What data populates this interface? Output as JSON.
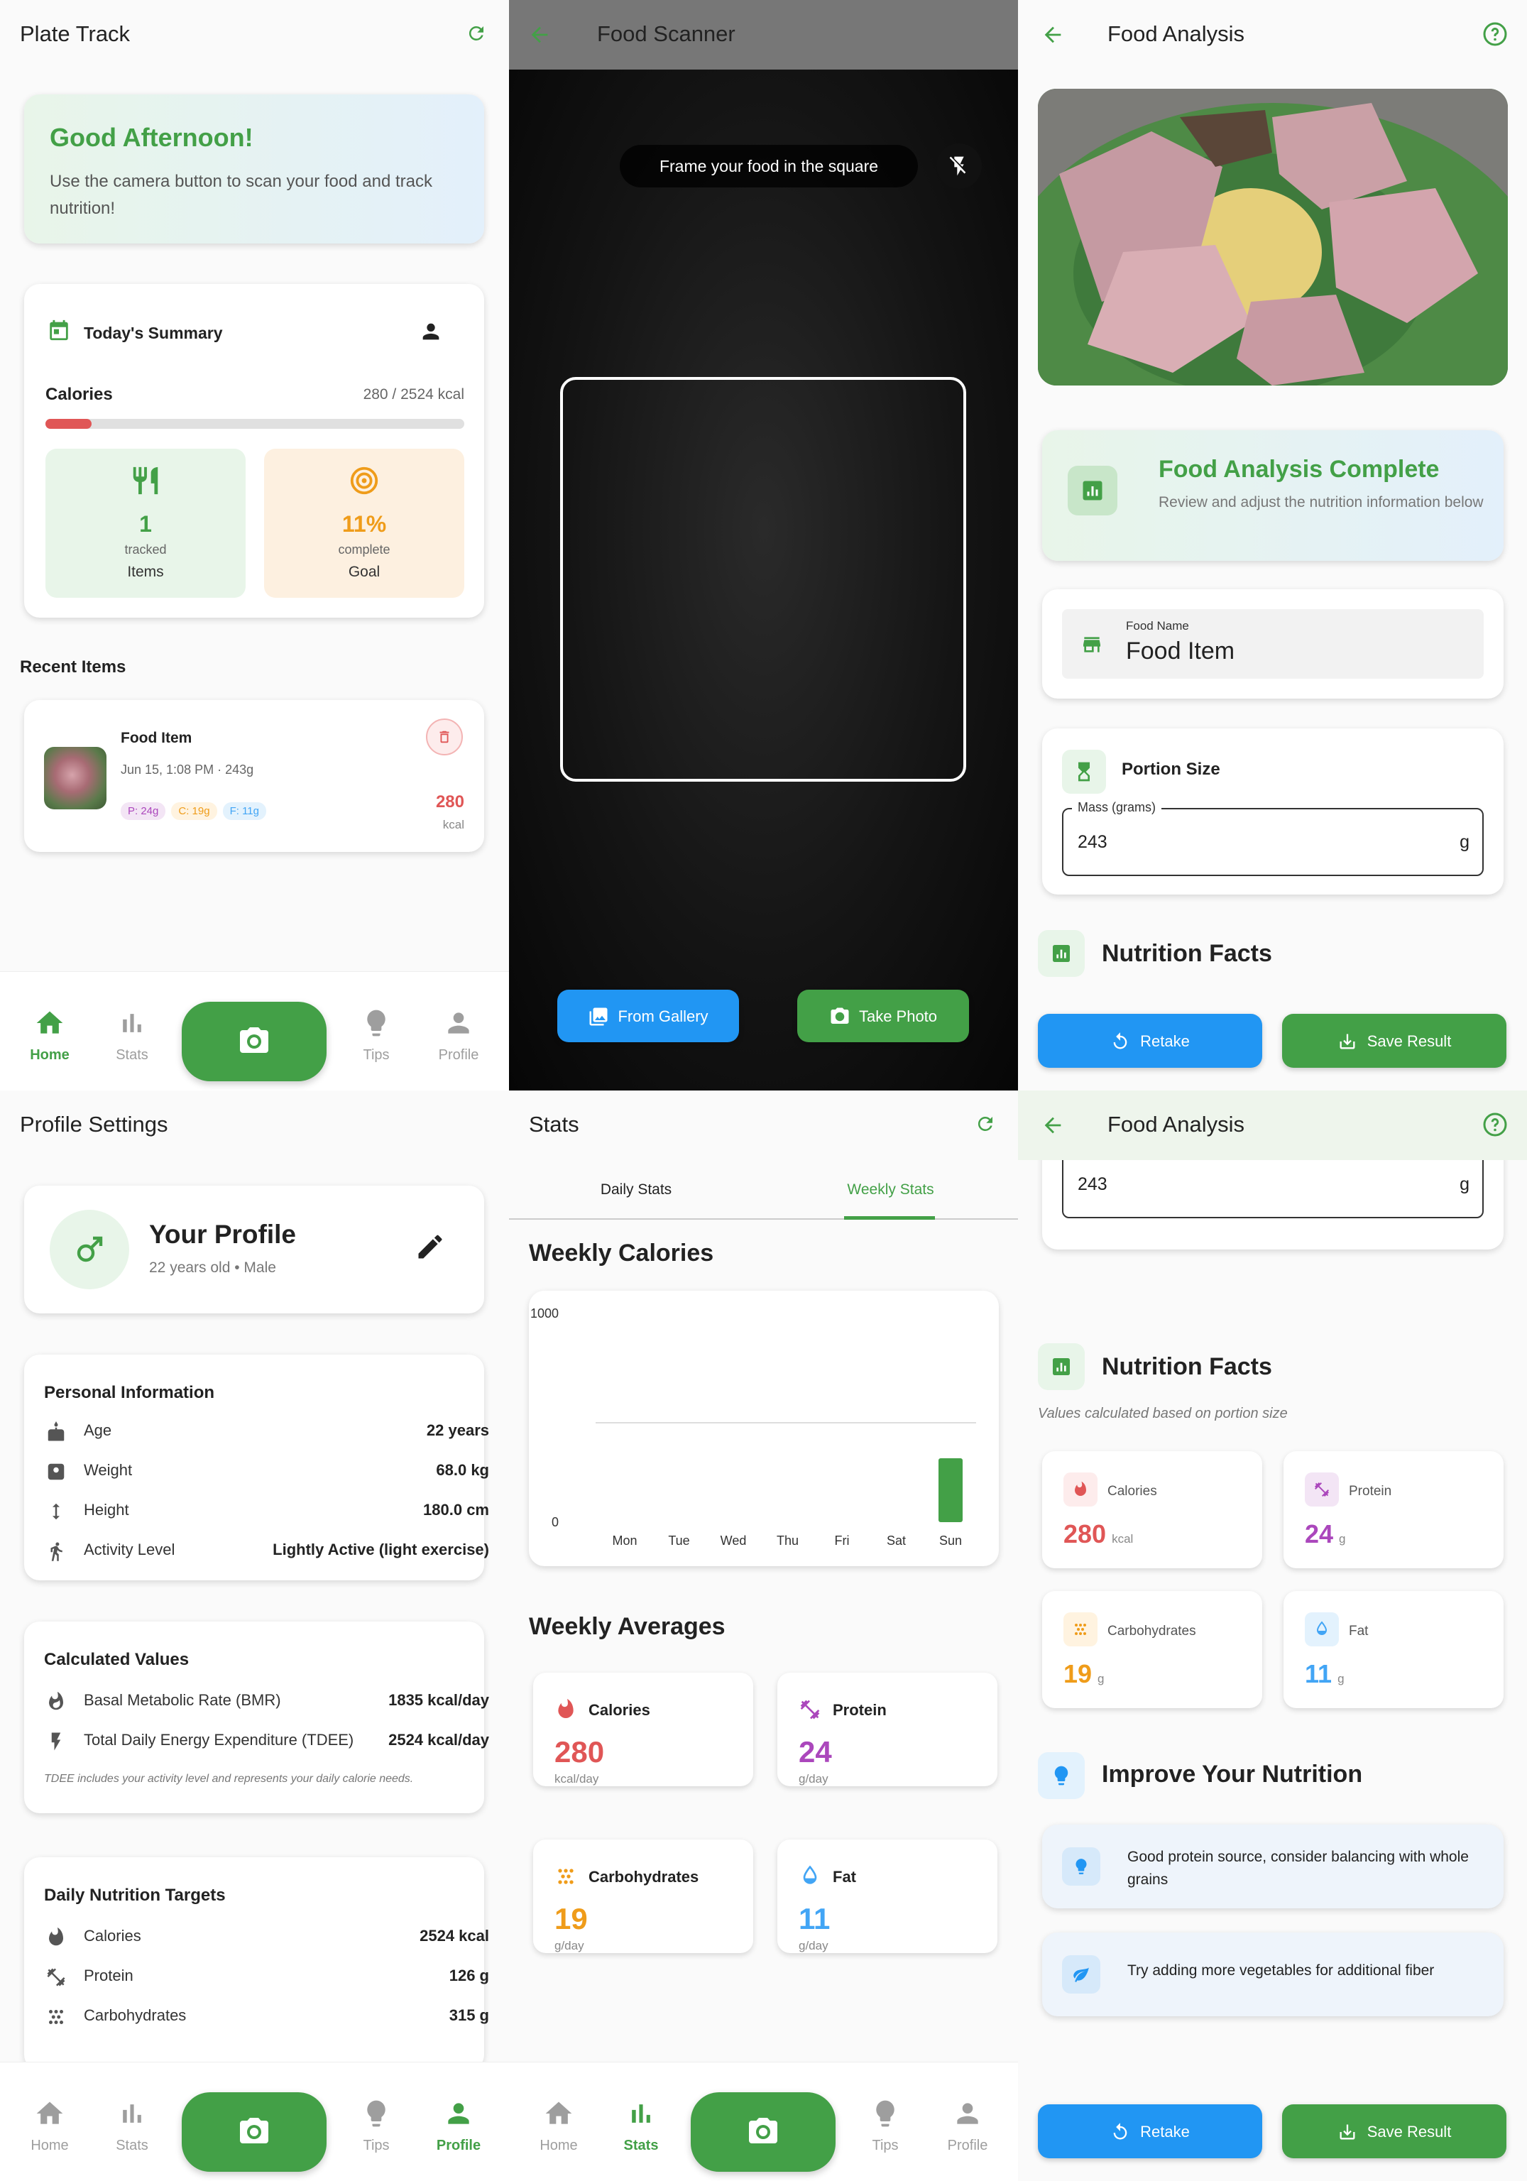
{
  "home": {
    "app_title": "Plate Track",
    "greeting_title": "Good Afternoon!",
    "greeting_text": "Use the camera button to scan your food and track nutrition!",
    "summary_title": "Today's Summary",
    "calories_label": "Calories",
    "calories_value": "280 / 2524 kcal",
    "calories_progress": 0.11,
    "items_count": "1",
    "items_sub": "tracked",
    "items_label": "Items",
    "goal_value": "11%",
    "goal_sub": "complete",
    "goal_label": "Goal",
    "recent_title": "Recent Items",
    "recent_item": {
      "name": "Food Item",
      "meta": "Jun 15, 1:08 PM · 243g",
      "protein_chip": "P: 24g",
      "carb_chip": "C: 19g",
      "fat_chip": "F: 11g",
      "kcal": "280",
      "kcal_unit": "kcal"
    }
  },
  "nav": {
    "home": "Home",
    "stats": "Stats",
    "tips": "Tips",
    "profile": "Profile"
  },
  "scanner": {
    "title": "Food Scanner",
    "hint": "Frame your food in the square",
    "gallery_button": "From Gallery",
    "photo_button": "Take Photo"
  },
  "analysis": {
    "title": "Food Analysis",
    "complete_title": "Food Analysis Complete",
    "complete_text": "Review and adjust the nutrition information below",
    "food_name_label": "Food Name",
    "food_name_value": "Food Item",
    "portion_title": "Portion Size",
    "mass_label": "Mass (grams)",
    "mass_value": "243",
    "mass_unit": "g",
    "nutrition_title": "Nutrition Facts",
    "nutrition_note": "Values calculated based on portion size",
    "calories_label": "Calories",
    "calories_value": "280",
    "calories_unit": "kcal",
    "protein_label": "Protein",
    "protein_value": "24",
    "protein_unit": "g",
    "carbs_label": "Carbohydrates",
    "carbs_value": "19",
    "carbs_unit": "g",
    "fat_label": "Fat",
    "fat_value": "11",
    "fat_unit": "g",
    "improve_title": "Improve Your Nutrition",
    "tip1": "Good protein source, consider balancing with whole grains",
    "tip2": "Try adding more vegetables for additional fiber",
    "retake_button": "Retake",
    "save_button": "Save Result"
  },
  "profile": {
    "title": "Profile Settings",
    "your_profile": "Your Profile",
    "profile_sub": "22 years old • Male",
    "personal_title": "Personal Information",
    "age_label": "Age",
    "age_value": "22 years",
    "weight_label": "Weight",
    "weight_value": "68.0 kg",
    "height_label": "Height",
    "height_value": "180.0 cm",
    "activity_label": "Activity Level",
    "activity_value": "Lightly Active (light exercise)",
    "calc_title": "Calculated Values",
    "bmr_label": "Basal Metabolic Rate (BMR)",
    "bmr_value": "1835 kcal/day",
    "tdee_label": "Total Daily Energy Expenditure (TDEE)",
    "tdee_value": "2524 kcal/day",
    "tdee_note": "TDEE includes your activity level and represents your daily calorie needs.",
    "targets_title": "Daily Nutrition Targets",
    "t_cal_label": "Calories",
    "t_cal_value": "2524 kcal",
    "t_pro_label": "Protein",
    "t_pro_value": "126 g",
    "t_carb_label": "Carbohydrates",
    "t_carb_value": "315 g"
  },
  "stats": {
    "title": "Stats",
    "tab_daily": "Daily Stats",
    "tab_weekly": "Weekly Stats",
    "weekly_cal_title": "Weekly Calories",
    "averages_title": "Weekly Averages",
    "avg_cal_label": "Calories",
    "avg_cal_value": "280",
    "avg_cal_unit": "kcal/day",
    "avg_pro_label": "Protein",
    "avg_pro_value": "24",
    "avg_pro_unit": "g/day",
    "avg_carb_label": "Carbohydrates",
    "avg_carb_value": "19",
    "avg_carb_unit": "g/day",
    "avg_fat_label": "Fat",
    "avg_fat_value": "11",
    "avg_fat_unit": "g/day"
  },
  "chart_data": {
    "type": "bar",
    "categories": [
      "Mon",
      "Tue",
      "Wed",
      "Thu",
      "Fri",
      "Sat",
      "Sun"
    ],
    "values": [
      0,
      0,
      0,
      0,
      0,
      0,
      280
    ],
    "ylim": [
      0,
      1000
    ],
    "y_ticks": [
      "0",
      "1000"
    ],
    "grid": true
  },
  "colors": {
    "primary_green": "#43a047",
    "blue_button": "#2196f3",
    "calories_red": "#e05656",
    "protein_purple": "#ab47bc",
    "carbs_orange": "#ef9c1a",
    "fat_blue": "#42a5f5"
  }
}
